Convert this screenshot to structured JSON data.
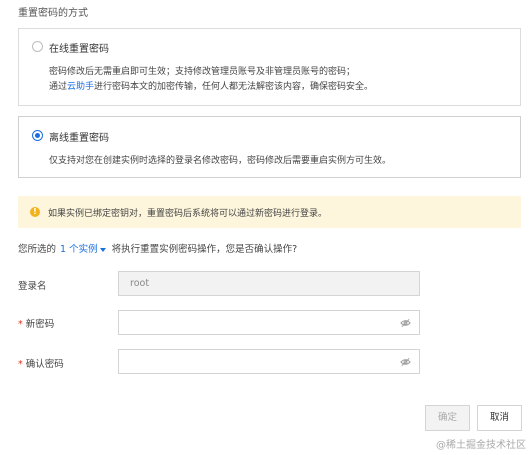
{
  "section_title": "重置密码的方式",
  "online_option": {
    "title": "在线重置密码",
    "desc_line1": "密码修改后无需重启即可生效；支持修改管理员账号及非管理员账号的密码；",
    "desc_line2_prefix": "通过",
    "desc_line2_link": "云助手",
    "desc_line2_suffix": "进行密码本文的加密传输，任何人都无法解密该内容，确保密码安全。",
    "selected": false
  },
  "offline_option": {
    "title": "离线重置密码",
    "desc_line1": "仅支持对您在创建实例时选择的登录名修改密码，密码修改后需要重启实例方可生效。",
    "selected": true
  },
  "notice": {
    "icon": "warning-icon",
    "text": "如果实例已绑定密钥对，重置密码后系统将可以通过新密码进行登录。"
  },
  "confirm": {
    "prefix": "您所选的",
    "count_label": "1 个实例",
    "suffix": "将执行重置实例密码操作，您是否确认操作?"
  },
  "form": {
    "login_label": "登录名",
    "login_value": "root",
    "new_password_label": "新密码",
    "confirm_password_label": "确认密码"
  },
  "buttons": {
    "ok": "确定",
    "cancel": "取消"
  },
  "watermark": "@稀土掘金技术社区",
  "colors": {
    "accent": "#1a6fe0",
    "required": "#e0341f",
    "notice_bg": "#fdf6dc",
    "warning": "#f2b21c"
  }
}
